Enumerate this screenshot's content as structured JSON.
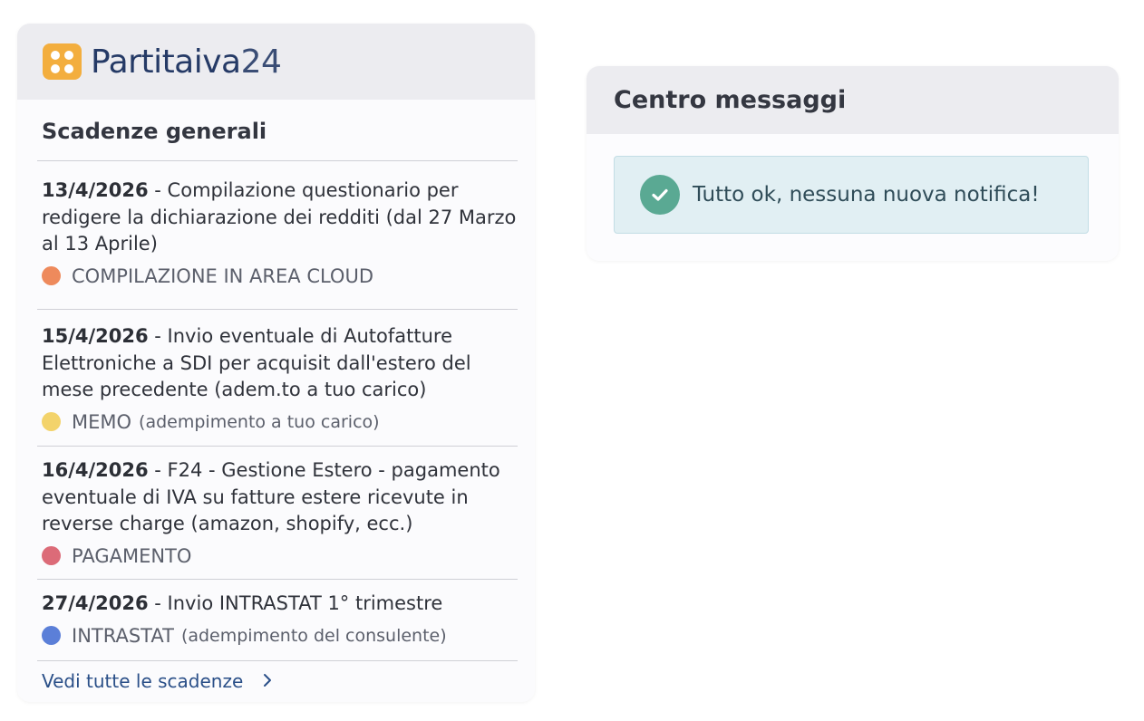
{
  "brand": {
    "name": "Partitaiva",
    "number": "24"
  },
  "deadlines": {
    "title": "Scadenze generali",
    "items": [
      {
        "date": "13/4/2026",
        "description": " - Compilazione questionario per redigere la dichiarazione dei redditi (dal 27 Marzo al 13 Aprile)",
        "tag": "COMPILAZIONE IN AREA CLOUD",
        "tag_note": "",
        "color": "#ee8a5c"
      },
      {
        "date": "15/4/2026",
        "description": " - Invio eventuale di Autofatture Elettroniche a SDI per acquisit dall'estero del mese precedente (adem.to a tuo carico)",
        "tag": "MEMO",
        "tag_note": "(adempimento a tuo carico)",
        "color": "#f3d36b"
      },
      {
        "date": "16/4/2026",
        "description": " - F24 - Gestione Estero - pagamento eventuale di IVA su fatture estere ricevute in reverse charge (amazon, shopify, ecc.)",
        "tag": "PAGAMENTO",
        "tag_note": "",
        "color": "#dc6b78"
      },
      {
        "date": "27/4/2026",
        "description": " - Invio INTRASTAT 1° trimestre",
        "tag": "INTRASTAT",
        "tag_note": "(adempimento del consulente)",
        "color": "#5b7fd8"
      }
    ],
    "more_link": "Vedi tutte le scadenze",
    "more_icon": "chevron-right-icon"
  },
  "messages": {
    "title": "Centro messaggi",
    "status": "Tutto ok, nessuna nuova notifica!",
    "status_icon": "check-circle-icon",
    "status_color": "#5aa993"
  }
}
